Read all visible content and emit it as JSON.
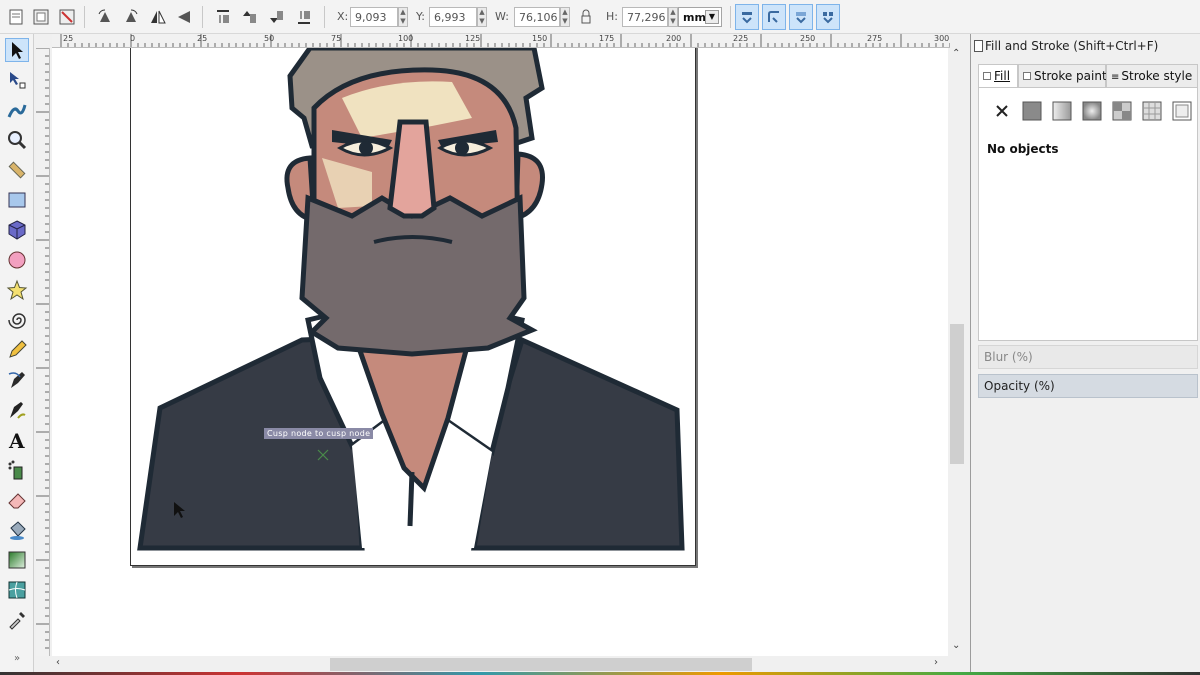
{
  "controls": {
    "x_label": "X:",
    "x_value": "9,093",
    "y_label": "Y:",
    "y_value": "6,993",
    "w_label": "W:",
    "w_value": "76,106",
    "h_label": "H:",
    "h_value": "77,296",
    "unit": "mm"
  },
  "ruler": {
    "h_ticks": [
      "25",
      "0",
      "25",
      "50",
      "75",
      "100",
      "125",
      "150",
      "175",
      "200",
      "225",
      "250",
      "275",
      "300"
    ]
  },
  "canvas": {
    "tooltip": "Cusp node to cusp node"
  },
  "panel": {
    "title": "Fill and Stroke (Shift+Ctrl+F)",
    "tab_fill": "Fill",
    "tab_stroke_paint": "Stroke paint",
    "tab_stroke_style": "Stroke style",
    "no_objects": "No objects",
    "blur_label": "Blur (%)",
    "opacity_label": "Opacity (%)"
  },
  "colors": {
    "accent": "#cde4fa",
    "jacket": "#363b45",
    "outline": "#1f2a35",
    "beard": "#746a6c",
    "skin": "#c58a7c",
    "highlight": "#f0e2c0"
  },
  "toolbox": {
    "tools": [
      "selector-tool",
      "node-tool",
      "tweak-tool",
      "zoom-tool",
      "measure-tool",
      "rectangle-tool",
      "3dbox-tool",
      "ellipse-tool",
      "star-tool",
      "spiral-tool",
      "pencil-tool",
      "pen-tool",
      "calligraphy-tool",
      "text-tool",
      "spray-tool",
      "eraser-tool",
      "bucket-tool",
      "gradient-tool",
      "mesh-tool",
      "dropper-tool"
    ]
  }
}
